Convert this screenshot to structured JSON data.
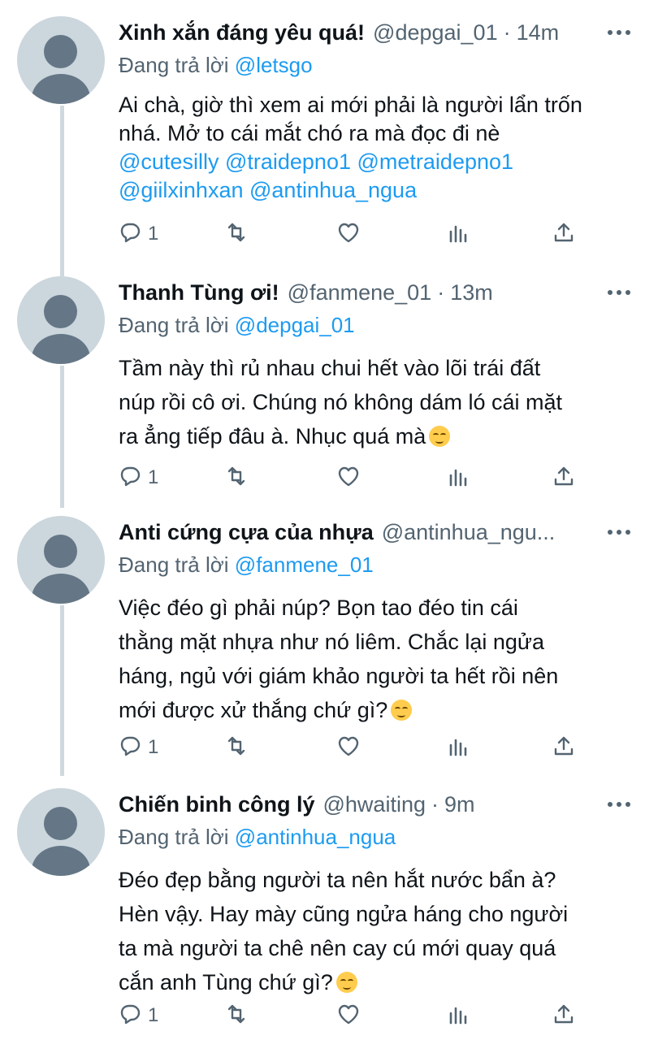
{
  "tweets": [
    {
      "name": "Xinh xắn đáng yêu quá!",
      "handle": "@depgai_01",
      "time": "14m",
      "reply_prefix": "Đang trả lời",
      "reply_to": "@letsgo",
      "lines": [
        [
          {
            "t": "Ai chà, giờ thì xem ai mới phải là người lẩn trốn",
            "m": false
          }
        ],
        [
          {
            "t": "nhá. Mở to cái mắt chó ra mà đọc đi nè",
            "m": false
          }
        ],
        [
          {
            "t": "@cutesilly",
            "m": true
          },
          {
            "t": " ",
            "m": false
          },
          {
            "t": "@traidepno1",
            "m": true
          },
          {
            "t": " ",
            "m": false
          },
          {
            "t": "@metraidepno1",
            "m": true
          }
        ],
        [
          {
            "t": "@giilxinhxan",
            "m": true
          },
          {
            "t": " ",
            "m": false
          },
          {
            "t": "@antinhua_ngua",
            "m": true
          }
        ]
      ],
      "reply_count": "1",
      "emoji": false
    },
    {
      "name": "Thanh Tùng ơi!",
      "handle": "@fanmene_01",
      "time": "13m",
      "reply_prefix": "Đang trả lời",
      "reply_to": "@depgai_01",
      "lines": [
        [
          {
            "t": "Tầm này thì rủ nhau chui hết vào lõi trái đất",
            "m": false
          }
        ],
        [
          {
            "t": "núp rồi cô ơi. Chúng nó không dám ló cái mặt",
            "m": false
          }
        ],
        [
          {
            "t": "ra ẳng tiếp đâu à. Nhục quá mà",
            "m": false
          }
        ]
      ],
      "reply_count": "1",
      "emoji": true,
      "emoji_name": "relieved-face-emoji"
    },
    {
      "name": "Anti cứng cựa của nhựa",
      "handle": "@antinhua_ngu...",
      "time": "",
      "reply_prefix": "Đang trả lời",
      "reply_to": "@fanmene_01",
      "lines": [
        [
          {
            "t": "Việc đéo gì phải núp? Bọn tao đéo tin cái",
            "m": false
          }
        ],
        [
          {
            "t": "thằng mặt nhựa như nó liêm. Chắc lại ngửa",
            "m": false
          }
        ],
        [
          {
            "t": "háng, ngủ với giám khảo người ta hết rồi nên",
            "m": false
          }
        ],
        [
          {
            "t": "mới được xử thắng chứ gì?",
            "m": false
          }
        ]
      ],
      "reply_count": "1",
      "emoji": true,
      "emoji_name": "smirking-face-emoji"
    },
    {
      "name": "Chiến binh công lý",
      "handle": "@hwaiting",
      "time": "9m",
      "reply_prefix": "Đang trả lời",
      "reply_to": "@antinhua_ngua",
      "lines": [
        [
          {
            "t": "Đéo đẹp bằng người ta nên hắt nước bẩn à?",
            "m": false
          }
        ],
        [
          {
            "t": "Hèn vậy. Hay mày cũng ngửa háng cho người",
            "m": false
          }
        ],
        [
          {
            "t": "ta mà người ta chê nên cay cú mới quay quá",
            "m": false
          }
        ],
        [
          {
            "t": "cắn anh Tùng chứ gì?",
            "m": false
          }
        ]
      ],
      "reply_count": "1",
      "emoji": true,
      "emoji_name": "relieved-face-emoji"
    }
  ],
  "colors": {
    "link": "#1d9bf0",
    "secondary_text": "#536471",
    "thread_line": "#cfd9de",
    "avatar_bg": "#ccd6dd",
    "avatar_fg": "#657786"
  },
  "icons": [
    "reply-icon",
    "retweet-icon",
    "like-icon",
    "analytics-icon",
    "share-icon",
    "more-icon"
  ]
}
